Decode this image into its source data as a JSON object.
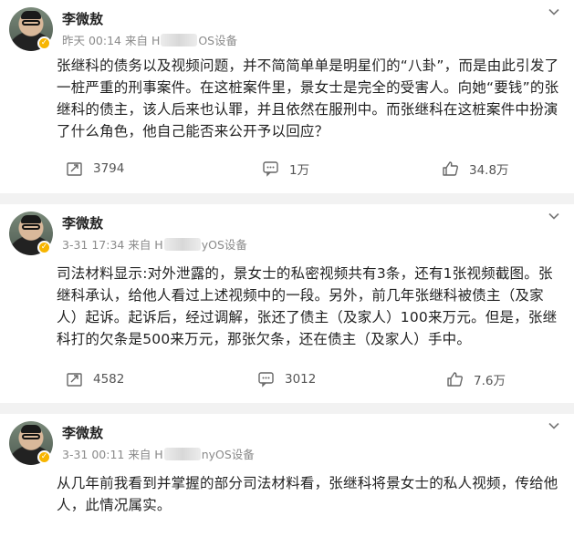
{
  "posts": [
    {
      "name": "李微敖",
      "badge": "✓",
      "meta_prefix": "昨天 00:14 来自 H",
      "meta_suffix": "OS设备",
      "content": "张继科的债务以及视频问题，并不简简单单是明星们的“八卦”，而是由此引发了一桩严重的刑事案件。在这桩案件里，景女士是完全的受害人。向她“要钱”的张继科的债主，该人后来也认罪，并且依然在服刑中。而张继科在这桩案件中扮演了什么角色，他自己能否来公开予以回应？",
      "reposts": "3794",
      "comments": "1万",
      "likes": "34.8万"
    },
    {
      "name": "李微敖",
      "badge": "✓",
      "meta_prefix": "3-31 17:34 来自 H",
      "meta_suffix": "yOS设备",
      "content": "司法材料显示:对外泄露的，景女士的私密视频共有3条，还有1张视频截图。张继科承认，给他人看过上述视频中的一段。另外，前几年张继科被债主（及家人）起诉。起诉后，经过调解，张还了债主（及家人）100来万元。但是，张继科打的欠条是500来万元，那张欠条，还在债主（及家人）手中。",
      "reposts": "4582",
      "comments": "3012",
      "likes": "7.6万"
    },
    {
      "name": "李微敖",
      "badge": "✓",
      "meta_prefix": "3-31 00:11 来自 H",
      "meta_suffix": "nyOS设备",
      "content": "从几年前我看到并掌握的部分司法材料看，张继科将景女士的私人视频，传给他人，此情况属实。"
    }
  ],
  "icons": {
    "repost": "repost-icon",
    "comment": "comment-icon",
    "like": "like-icon",
    "menu": "chevron-down-icon"
  },
  "colors": {
    "badge": "#f7b500",
    "separator": "#f2f2f2"
  }
}
